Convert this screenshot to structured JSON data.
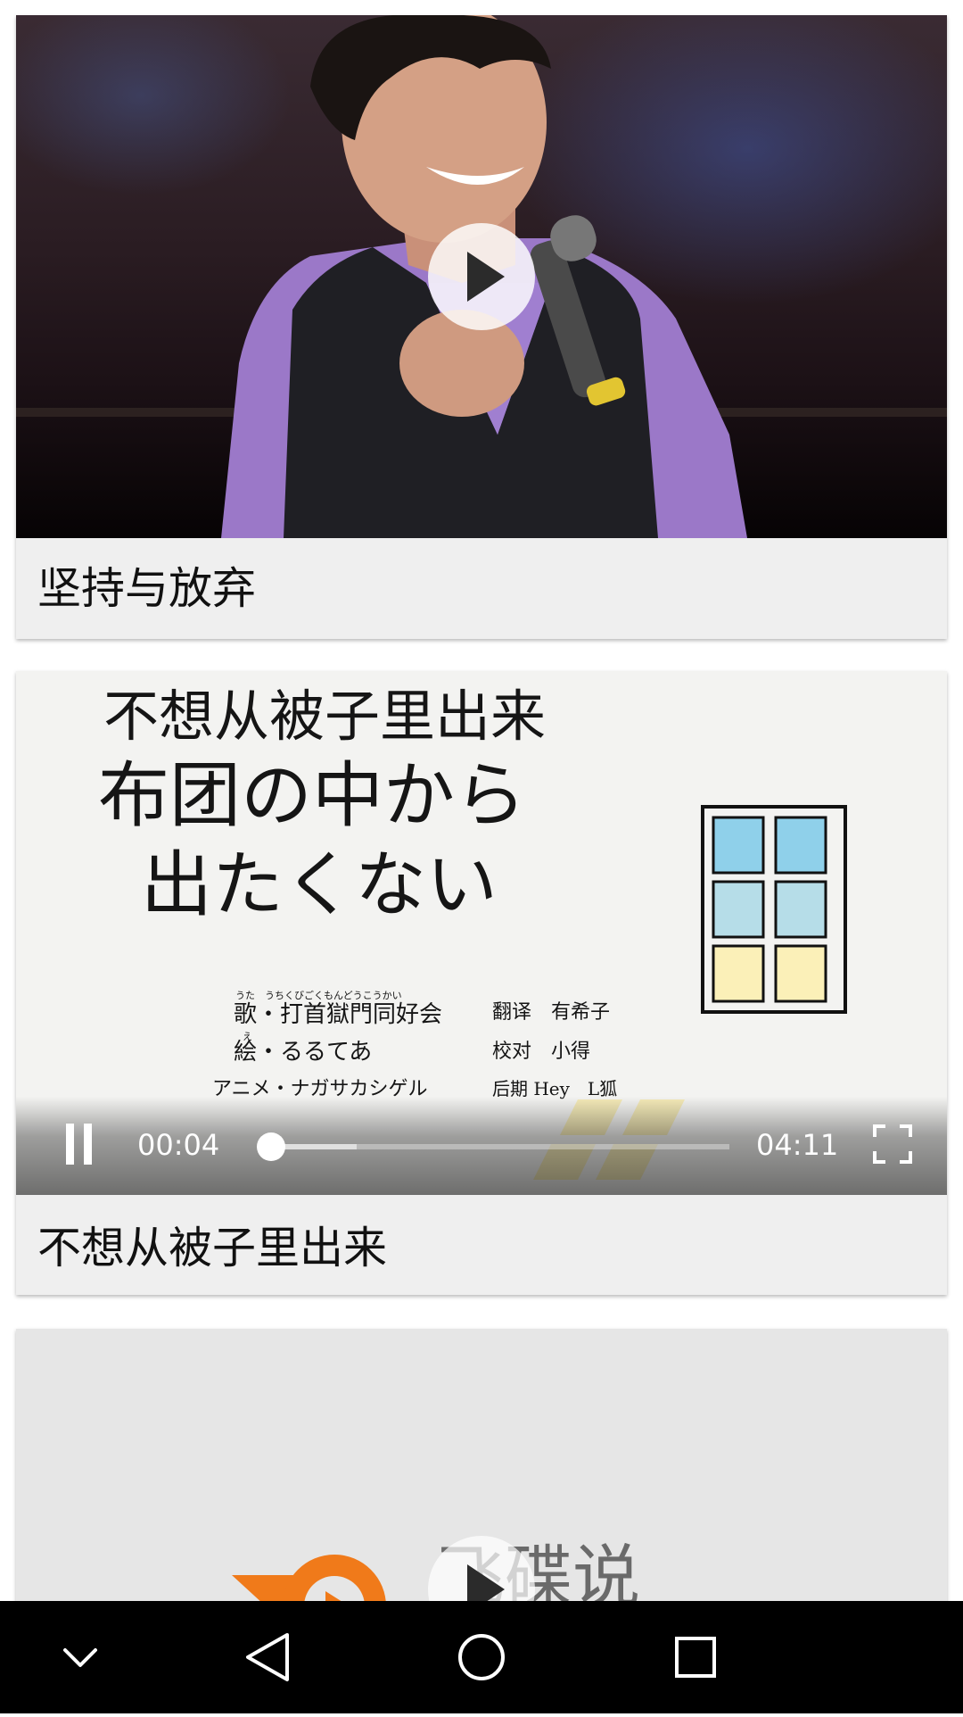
{
  "feed": {
    "items": [
      {
        "title": "坚持与放弃"
      },
      {
        "title": "不想从被子里出来",
        "cover": {
          "line1": "不想从被子里出来",
          "line2": "布团の中から",
          "line3": "出たくない",
          "credits": {
            "song_ruby": "うた　うちくびごくもんどうこうかい",
            "song": "歌・打首獄門同好会",
            "art_ruby": "え",
            "art": "絵・るるてあ",
            "anime": "アニメ・ナガサカシゲル",
            "translate": "翻译　有希子",
            "proof": "校对　小得",
            "post": "后期 Hey　L狐"
          }
        },
        "player": {
          "current_time": "00:04",
          "duration": "04:11",
          "progress_fraction": 0.016,
          "buffered_fraction": 0.2
        }
      },
      {
        "cover_text": "飞碟说"
      }
    ]
  },
  "icons": {
    "play": "play-icon",
    "pause": "pause-icon",
    "fullscreen": "fullscreen-icon",
    "nav": [
      "chevron-down-icon",
      "back-icon",
      "home-icon",
      "recents-icon"
    ]
  },
  "colors": {
    "card_bg": "#efefef",
    "navbar_bg": "#000000",
    "accent_orange": "#f07a1a"
  }
}
